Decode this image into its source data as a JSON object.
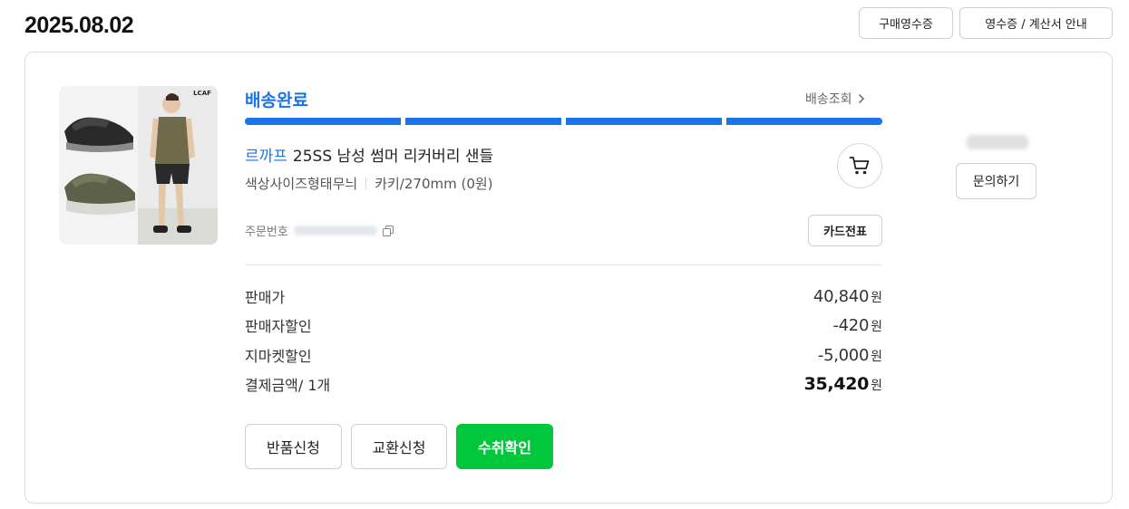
{
  "order": {
    "date": "2025.08.02",
    "receipt_button": "구매영수증",
    "receipt_guide_button": "영수증 / 계산서 안내",
    "status": "배송완료",
    "track_link": "배송조회",
    "progress_steps_done": 4,
    "progress_steps_total": 4,
    "brand": "르까프",
    "product_name": "25SS 남성 썸머 리커버리 샌들",
    "option_label": "색상사이즈형태무늬",
    "option_value": "카키/270mm (0원)",
    "order_no_label": "주문번호",
    "card_slip_button": "카드전표",
    "prices": [
      {
        "label": "판매가",
        "value": "40,840",
        "unit": "원"
      },
      {
        "label": "판매자할인",
        "value": "-420",
        "unit": "원"
      },
      {
        "label": "지마켓할인",
        "value": "-5,000",
        "unit": "원"
      },
      {
        "label": "결제금액/ 1개",
        "value": "35,420",
        "unit": "원"
      }
    ],
    "actions": {
      "return": "반품신청",
      "exchange": "교환신청",
      "confirm": "수취확인"
    },
    "inquiry_button": "문의하기",
    "colors": {
      "status_blue": "#1a73e8",
      "confirm_green": "#00c73c"
    },
    "icons": {
      "cart": "cart-icon",
      "chevron": "chevron-right-icon",
      "copy": "copy-icon"
    },
    "image_logo_text": "LCAF"
  }
}
